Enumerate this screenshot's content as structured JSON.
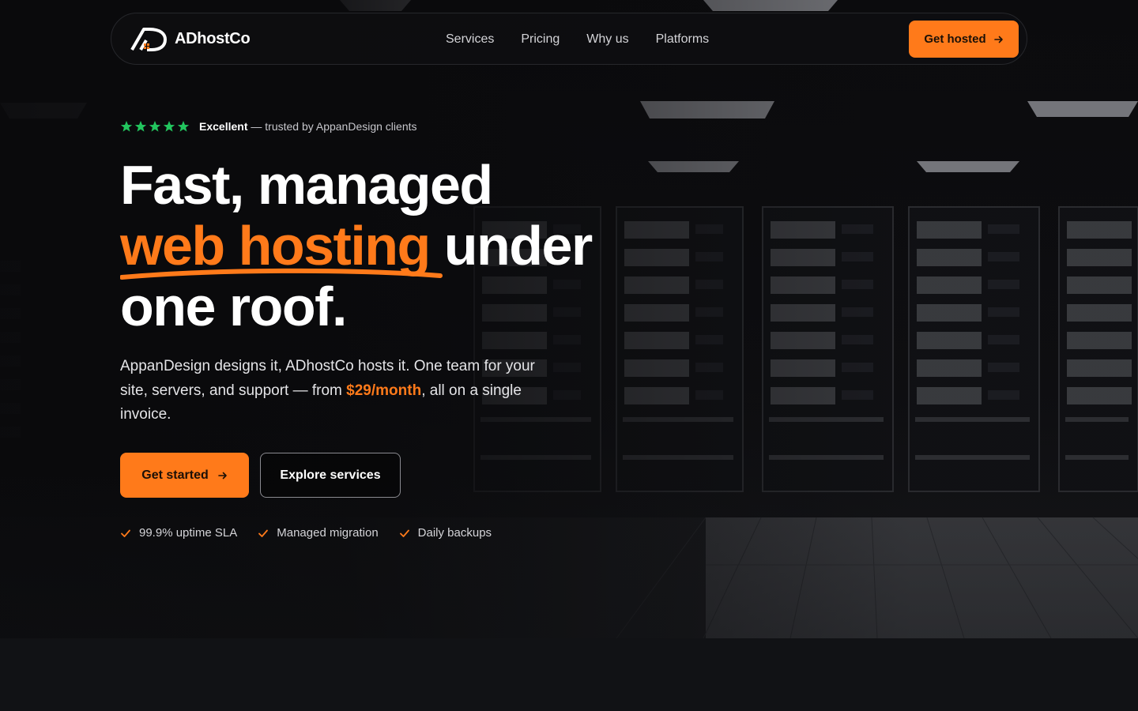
{
  "brand": {
    "name": "ADhostCo"
  },
  "nav": {
    "links": [
      "Services",
      "Pricing",
      "Why us",
      "Platforms"
    ],
    "cta_label": "Get hosted"
  },
  "rating": {
    "stars": 5,
    "strong": "Excellent",
    "rest": " — trusted by AppanDesign clients"
  },
  "headline": {
    "line1": "Fast, managed",
    "accent": "web hosting",
    "line2_rest": " under",
    "line3": "one roof."
  },
  "lead": {
    "part1": "AppanDesign designs it, ADhostCo hosts it. One team for your site, servers, and support — from ",
    "price": "$29/month",
    "part2": ", all on a single invoice."
  },
  "buttons": {
    "primary": "Get started",
    "secondary": "Explore services"
  },
  "features": [
    "99.9% uptime SLA",
    "Managed migration",
    "Daily backups"
  ],
  "colors": {
    "accent": "#ff7a1a",
    "star": "#22c55e",
    "background": "#111215"
  },
  "icons": {
    "logo": "adhostco-logo",
    "star": "star-icon",
    "arrow": "arrow-right-icon",
    "check": "check-icon"
  }
}
